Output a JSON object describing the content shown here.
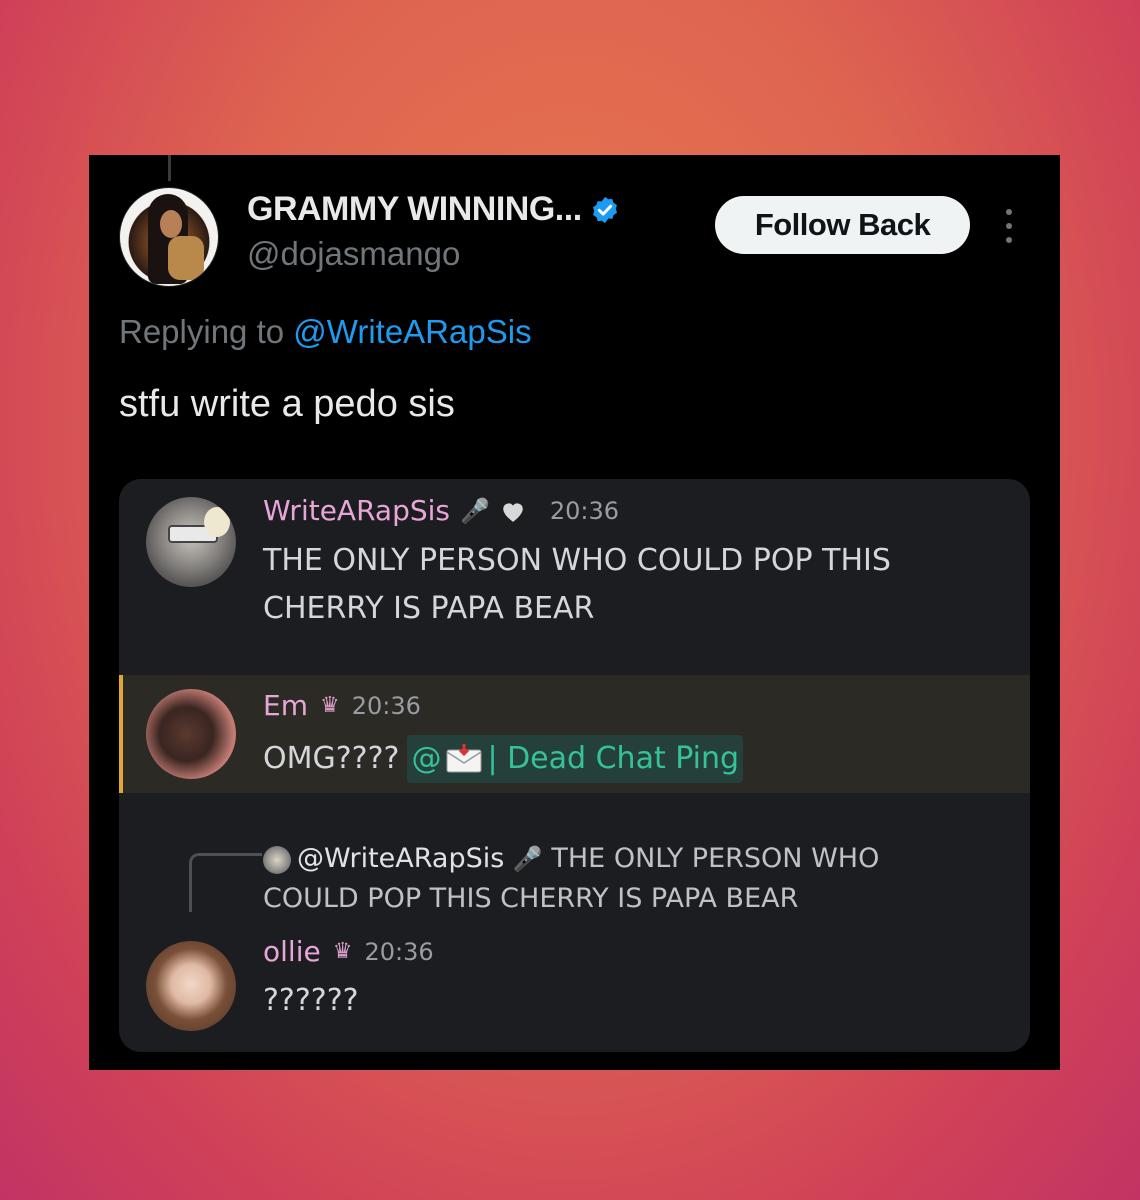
{
  "tweet": {
    "display_name": "GRAMMY WINNING...",
    "handle": "@dojasmango",
    "follow_label": "Follow Back",
    "replying_prefix": "Replying to",
    "replying_to": "@WriteARapSis",
    "text": "stfu write a pedo sis",
    "colors": {
      "accent": "#1d9bf0",
      "background": "#000000"
    }
  },
  "discord": {
    "msg1": {
      "name": "WriteARapSis",
      "time": "20:36",
      "text": "THE ONLY PERSON WHO COULD POP THIS CHERRY IS PAPA BEAR"
    },
    "msg2": {
      "name": "Em",
      "time": "20:36",
      "text": "OMG????",
      "role_mention": "| Dead Chat Ping",
      "at": "@"
    },
    "reply_ref": {
      "name": "@WriteARapSis",
      "text": "THE ONLY PERSON WHO COULD POP THIS CHERRY IS PAPA BEAR"
    },
    "msg3": {
      "name": "ollie",
      "time": "20:36",
      "text": "??????"
    },
    "icons": [
      "microphone-icon",
      "heart-icon",
      "crown-icon",
      "envelope-icon"
    ]
  }
}
